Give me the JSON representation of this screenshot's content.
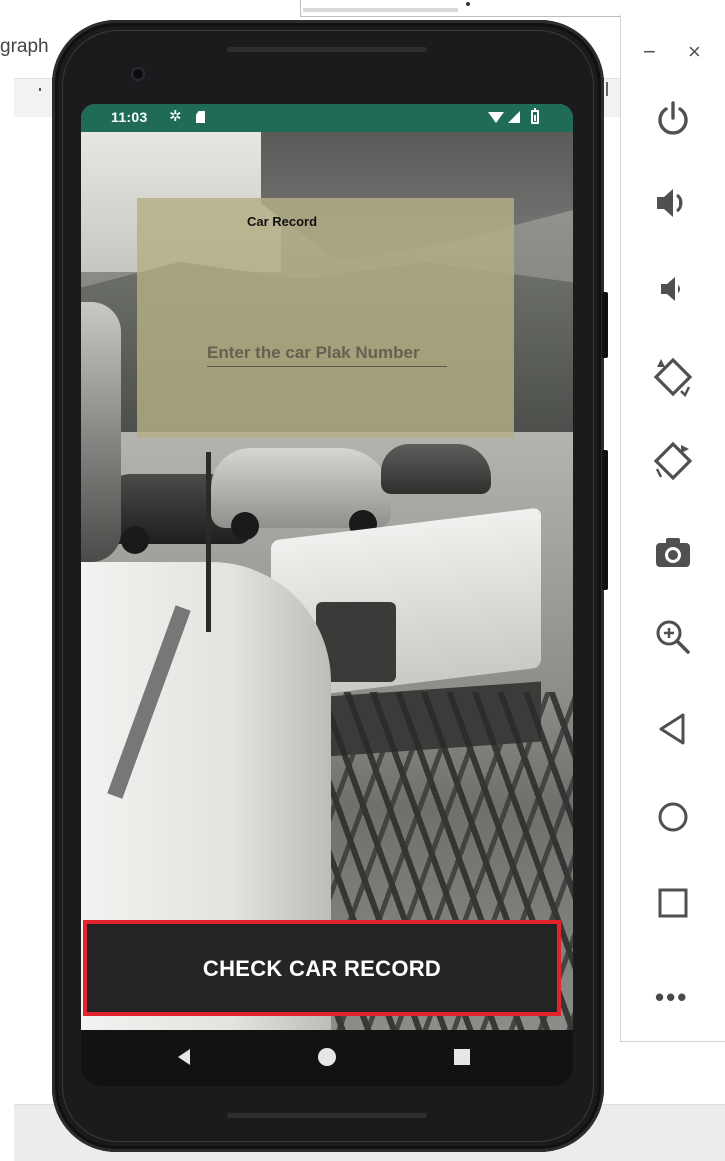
{
  "ide": {
    "partial_label": "graph"
  },
  "status_bar": {
    "time": "11:03"
  },
  "app": {
    "card_title": "Car Record",
    "plate_input_placeholder": "Enter the car Plak Number",
    "check_button_label": "CHECK CAR RECORD"
  },
  "emulator_toolbar": {
    "minimize": "−",
    "close": "×",
    "more": "•••",
    "icons": [
      "power-icon",
      "volume-up-icon",
      "volume-down-icon",
      "rotate-left-icon",
      "rotate-right-icon",
      "camera-icon",
      "zoom-in-icon",
      "back-icon",
      "home-icon",
      "overview-icon"
    ]
  },
  "colors": {
    "status_bar": "#1f6b55",
    "button_border": "#e3222b",
    "button_bg": "#252525",
    "card_overlay": "#b4af84"
  }
}
